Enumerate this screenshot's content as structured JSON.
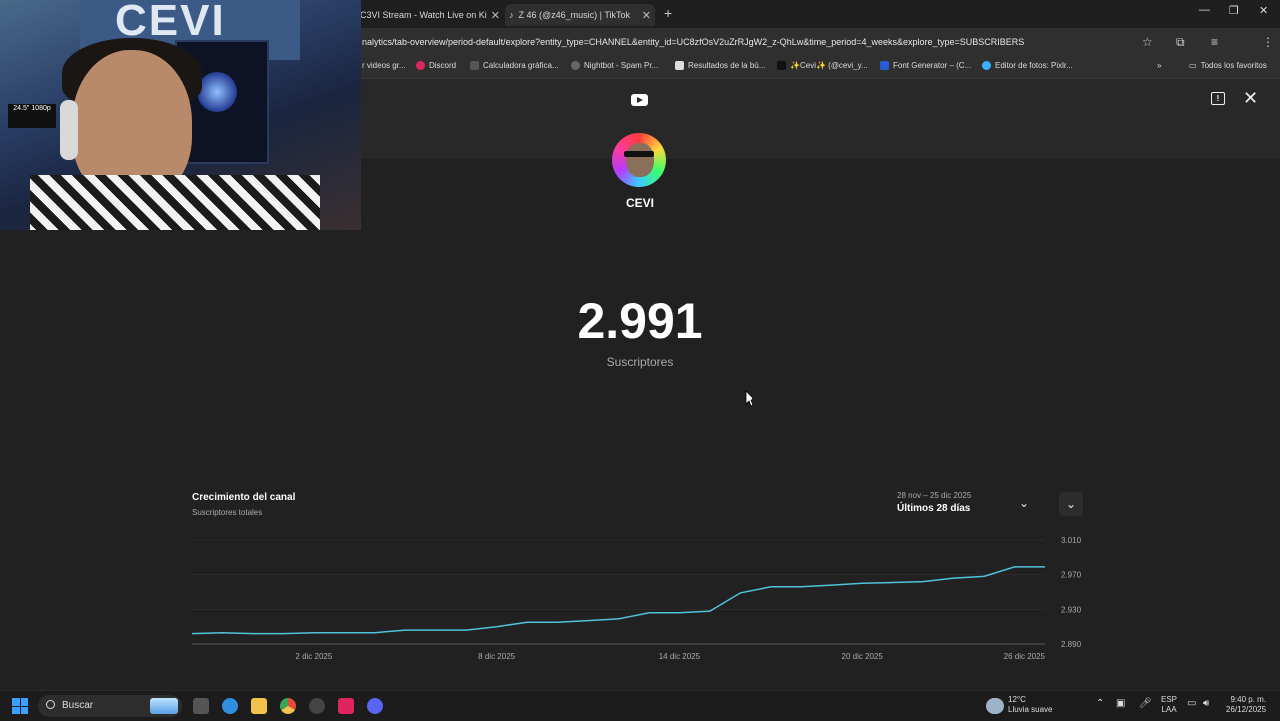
{
  "browser": {
    "tabs": [
      {
        "label": "C3VI Stream - Watch Live on Ki"
      },
      {
        "label": "Z 46 (@z46_music) | TikTok"
      }
    ],
    "url": "nalytics/tab-overview/period-default/explore?entity_type=CHANNEL&entity_id=UC8zfOsV2uZrRJgW2_z-QhLw&time_period=4_weeks&explore_type=SUBSCRIBERS",
    "bookmarks": [
      "r videos gr...",
      "Discord",
      "Calculadora gráfica...",
      "Nightbot - Spam Pr...",
      "Resultados de la bú...",
      "✨Cevi✨ (@cevi_y...",
      "Font Generator – (C...",
      "Editor de fotos: Pixlr...",
      "Todos los favoritos"
    ]
  },
  "page": {
    "channel_name": "CEVI",
    "subscriber_count": "2.991",
    "subscriber_label": "Suscriptores"
  },
  "card": {
    "title": "Crecimiento del canal",
    "subtitle": "Suscriptores totales",
    "range_dates": "28 nov – 25 dic 2025",
    "range_label": "Últimos 28 días"
  },
  "chart_data": {
    "type": "line",
    "title": "Crecimiento del canal",
    "subtitle": "Suscriptores totales",
    "x_ticks": [
      "2 dic 2025",
      "8 dic 2025",
      "14 dic 2025",
      "20 dic 2025",
      "26 dic 2025"
    ],
    "y_ticks": [
      "3.010",
      "2.970",
      "2.930",
      "2.890"
    ],
    "ylim": [
      2890,
      3010
    ],
    "grid": true,
    "series": [
      {
        "color": "#4fc3dc",
        "x": [
          "28 nov",
          "29 nov",
          "30 nov",
          "1 dic",
          "2 dic",
          "3 dic",
          "4 dic",
          "5 dic",
          "6 dic",
          "7 dic",
          "8 dic",
          "9 dic",
          "10 dic",
          "11 dic",
          "12 dic",
          "13 dic",
          "14 dic",
          "15 dic",
          "16 dic",
          "17 dic",
          "18 dic",
          "19 dic",
          "20 dic",
          "21 dic",
          "22 dic",
          "23 dic",
          "24 dic",
          "25 dic",
          "26 dic"
        ],
        "values": [
          2902,
          2903,
          2902,
          2902,
          2903,
          2903,
          2903,
          2906,
          2906,
          2906,
          2910,
          2915,
          2915,
          2917,
          2919,
          2926,
          2926,
          2928,
          2949,
          2956,
          2956,
          2958,
          2960,
          2961,
          2962,
          2966,
          2968,
          2979,
          2979
        ]
      }
    ]
  },
  "taskbar": {
    "search_label": "Buscar",
    "weather_temp": "12°C",
    "weather_desc": "Lluvia suave",
    "lang_top": "ESP",
    "lang_bottom": "LAA",
    "time": "9:40 p. m.",
    "date": "26/12/2025"
  },
  "webcam": {
    "monitor_text": "24.5\" 1080p",
    "logo_text": "CEVI"
  }
}
